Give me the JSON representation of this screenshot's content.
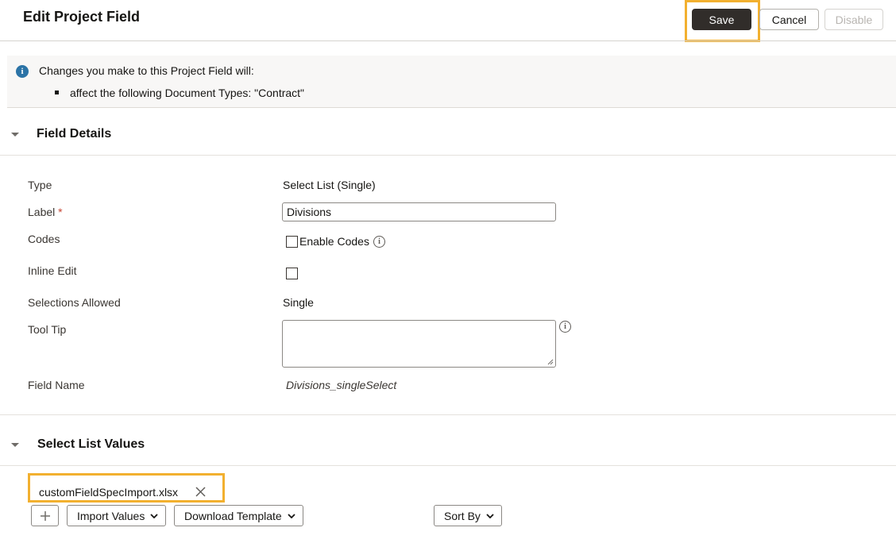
{
  "header": {
    "title": "Edit Project Field",
    "save_label": "Save",
    "cancel_label": "Cancel",
    "disable_label": "Disable"
  },
  "banner": {
    "text": "Changes you make to this Project Field will:",
    "items": [
      "affect the following Document Types: \"Contract\""
    ]
  },
  "field_details": {
    "title": "Field Details",
    "rows": {
      "type": {
        "label": "Type",
        "value": "Select List (Single)"
      },
      "label": {
        "label": "Label",
        "required_mark": "*",
        "value": "Divisions"
      },
      "codes": {
        "label": "Codes",
        "checkbox_label": "Enable Codes",
        "checked": false
      },
      "inline_edit": {
        "label": "Inline Edit",
        "checked": false
      },
      "selections_allowed": {
        "label": "Selections Allowed",
        "value": "Single"
      },
      "tool_tip": {
        "label": "Tool Tip",
        "value": ""
      },
      "field_name": {
        "label": "Field Name",
        "value": "Divisions_singleSelect"
      }
    }
  },
  "select_list_values": {
    "title": "Select List Values",
    "file_name": "customFieldSpecImport.xlsx",
    "toolbar": {
      "import_label": "Import Values",
      "download_label": "Download Template",
      "sort_label": "Sort By"
    }
  },
  "colors": {
    "highlight": "#f2b02f",
    "primary_button": "#312d2a",
    "info_icon": "#2b73a6",
    "required": "#c74634"
  },
  "icons": {
    "info": "info-icon",
    "help": "info-circle-icon",
    "collapse": "chevron-down-icon",
    "remove": "close-icon",
    "add": "plus-icon",
    "dropdown": "chevron-down-icon"
  }
}
